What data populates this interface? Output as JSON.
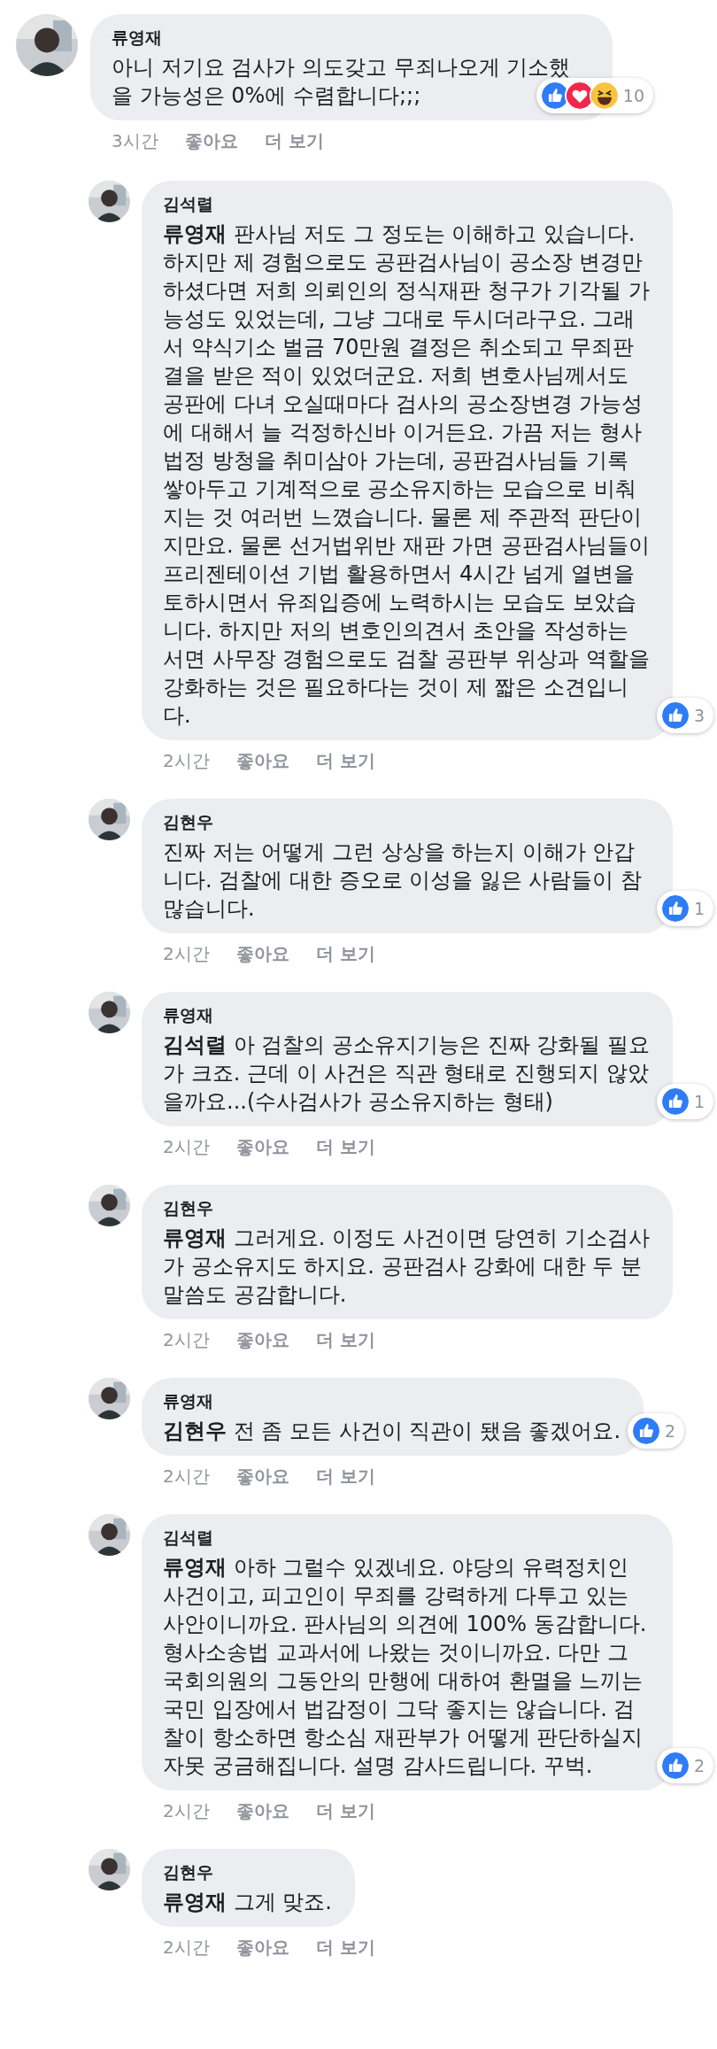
{
  "comments": [
    {
      "author": "류영재",
      "text": "아니 저기요 검사가 의도갖고 무죄나오게 기소했을 가능성은 0%에 수렴합니다;;;",
      "reactions": {
        "icons": [
          {
            "kind": "like"
          },
          {
            "kind": "love"
          },
          {
            "kind": "haha"
          }
        ],
        "count": "10"
      },
      "meta": {
        "time": "3시간",
        "like": "좋아요",
        "more": "더 보기"
      },
      "replies": [
        {
          "author": "김석렬",
          "text": "**류영재** 판사님 저도 그 정도는 이해하고 있습니다. 하지만 제 경험으로도 공판검사님이 공소장 변경만 하셨다면 저희 의뢰인의 정식재판 청구가 기각될 가능성도 있었는데, 그냥 그대로 두시더라구요. 그래서 약식기소 벌금 70만원 결정은 취소되고 무죄판결을 받은 적이 있었더군요. 저희 변호사님께서도 공판에 다녀 오실때마다 검사의 공소장변경 가능성에 대해서 늘 걱정하신바 이거든요. 가끔 저는 형사법정 방청을 취미삼아 가는데, 공판검사님들 기록 쌓아두고 기계적으로 공소유지하는 모습으로 비춰지는 것 여러번 느꼈습니다. 물론 제 주관적 판단이지만요. 물론 선거법위반 재판 가면 공판검사님들이 프리젠테이션 기법 활용하면서 4시간 넘게 열변을 토하시면서 유죄입증에 노력하시는 모습도 보았습니다. 하지만 저의 변호인의견서 초안을 작성하는 서면 사무장 경험으로도 검찰 공판부 위상과 역할을 강화하는 것은 필요하다는 것이 제 짧은 소견입니다.",
          "reactions": {
            "icons": [
              {
                "kind": "like"
              }
            ],
            "count": "3"
          },
          "meta": {
            "time": "2시간",
            "like": "좋아요",
            "more": "더 보기"
          }
        },
        {
          "author": "김현우",
          "text": "진짜 저는 어떻게 그런 상상을 하는지 이해가 안갑니다. 검찰에 대한 증오로 이성을 잃은 사람들이 참 많습니다.",
          "reactions": {
            "icons": [
              {
                "kind": "like"
              }
            ],
            "count": "1"
          },
          "meta": {
            "time": "2시간",
            "like": "좋아요",
            "more": "더 보기"
          }
        },
        {
          "author": "류영재",
          "text": "**김석렬** 아 검찰의 공소유지기능은 진짜 강화될 필요가 크죠. 근데 이 사건은 직관 형태로 진행되지 않았을까요...(수사검사가 공소유지하는 형태)",
          "reactions": {
            "icons": [
              {
                "kind": "like"
              }
            ],
            "count": "1"
          },
          "meta": {
            "time": "2시간",
            "like": "좋아요",
            "more": "더 보기"
          }
        },
        {
          "author": "김현우",
          "text": "**류영재** 그러게요. 이정도 사건이면 당연히 기소검사가 공소유지도 하지요. 공판검사 강화에 대한 두 분 말씀도 공감합니다.",
          "meta": {
            "time": "2시간",
            "like": "좋아요",
            "more": "더 보기"
          }
        },
        {
          "author": "류영재",
          "text": "**김현우** 전 좀 모든 사건이 직관이 됐음 좋겠어요.",
          "reactions": {
            "icons": [
              {
                "kind": "like"
              }
            ],
            "count": "2"
          },
          "meta": {
            "time": "2시간",
            "like": "좋아요",
            "more": "더 보기"
          }
        },
        {
          "author": "김석렬",
          "text": "**류영재** 아하 그럴수 있겠네요. 야당의 유력정치인 사건이고, 피고인이 무죄를 강력하게 다투고 있는 사안이니까요. 판사님의 의견에 100% 동감합니다. 형사소송법 교과서에 나왔는 것이니까요. 다만 그 국회의원의 그동안의 만행에 대하여 환멸을 느끼는 국민 입장에서 법감정이 그닥 좋지는 않습니다. 검찰이 항소하면 항소심 재판부가 어떻게 판단하실지 자못 궁금해집니다. 설명 감사드립니다. 꾸벅.",
          "reactions": {
            "icons": [
              {
                "kind": "like"
              }
            ],
            "count": "2"
          },
          "meta": {
            "time": "2시간",
            "like": "좋아요",
            "more": "더 보기"
          }
        },
        {
          "author": "김현우",
          "text": "**류영재** 그게 맞죠.",
          "meta": {
            "time": "2시간",
            "like": "좋아요",
            "more": "더 보기"
          }
        }
      ]
    }
  ]
}
